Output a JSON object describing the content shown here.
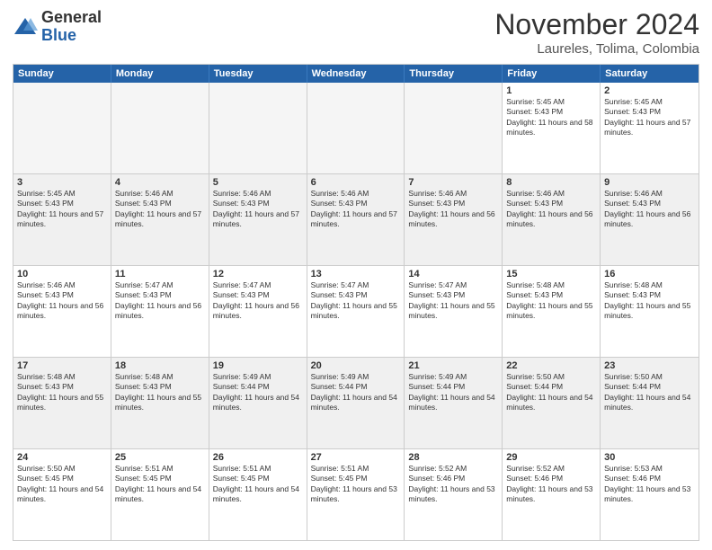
{
  "logo": {
    "general": "General",
    "blue": "Blue"
  },
  "header": {
    "month": "November 2024",
    "location": "Laureles, Tolima, Colombia"
  },
  "days_of_week": [
    "Sunday",
    "Monday",
    "Tuesday",
    "Wednesday",
    "Thursday",
    "Friday",
    "Saturday"
  ],
  "rows": [
    [
      {
        "day": "",
        "empty": true
      },
      {
        "day": "",
        "empty": true
      },
      {
        "day": "",
        "empty": true
      },
      {
        "day": "",
        "empty": true
      },
      {
        "day": "",
        "empty": true
      },
      {
        "day": "1",
        "sunrise": "Sunrise: 5:45 AM",
        "sunset": "Sunset: 5:43 PM",
        "daylight": "Daylight: 11 hours and 58 minutes."
      },
      {
        "day": "2",
        "sunrise": "Sunrise: 5:45 AM",
        "sunset": "Sunset: 5:43 PM",
        "daylight": "Daylight: 11 hours and 57 minutes."
      }
    ],
    [
      {
        "day": "3",
        "sunrise": "Sunrise: 5:45 AM",
        "sunset": "Sunset: 5:43 PM",
        "daylight": "Daylight: 11 hours and 57 minutes."
      },
      {
        "day": "4",
        "sunrise": "Sunrise: 5:46 AM",
        "sunset": "Sunset: 5:43 PM",
        "daylight": "Daylight: 11 hours and 57 minutes."
      },
      {
        "day": "5",
        "sunrise": "Sunrise: 5:46 AM",
        "sunset": "Sunset: 5:43 PM",
        "daylight": "Daylight: 11 hours and 57 minutes."
      },
      {
        "day": "6",
        "sunrise": "Sunrise: 5:46 AM",
        "sunset": "Sunset: 5:43 PM",
        "daylight": "Daylight: 11 hours and 57 minutes."
      },
      {
        "day": "7",
        "sunrise": "Sunrise: 5:46 AM",
        "sunset": "Sunset: 5:43 PM",
        "daylight": "Daylight: 11 hours and 56 minutes."
      },
      {
        "day": "8",
        "sunrise": "Sunrise: 5:46 AM",
        "sunset": "Sunset: 5:43 PM",
        "daylight": "Daylight: 11 hours and 56 minutes."
      },
      {
        "day": "9",
        "sunrise": "Sunrise: 5:46 AM",
        "sunset": "Sunset: 5:43 PM",
        "daylight": "Daylight: 11 hours and 56 minutes."
      }
    ],
    [
      {
        "day": "10",
        "sunrise": "Sunrise: 5:46 AM",
        "sunset": "Sunset: 5:43 PM",
        "daylight": "Daylight: 11 hours and 56 minutes."
      },
      {
        "day": "11",
        "sunrise": "Sunrise: 5:47 AM",
        "sunset": "Sunset: 5:43 PM",
        "daylight": "Daylight: 11 hours and 56 minutes."
      },
      {
        "day": "12",
        "sunrise": "Sunrise: 5:47 AM",
        "sunset": "Sunset: 5:43 PM",
        "daylight": "Daylight: 11 hours and 56 minutes."
      },
      {
        "day": "13",
        "sunrise": "Sunrise: 5:47 AM",
        "sunset": "Sunset: 5:43 PM",
        "daylight": "Daylight: 11 hours and 55 minutes."
      },
      {
        "day": "14",
        "sunrise": "Sunrise: 5:47 AM",
        "sunset": "Sunset: 5:43 PM",
        "daylight": "Daylight: 11 hours and 55 minutes."
      },
      {
        "day": "15",
        "sunrise": "Sunrise: 5:48 AM",
        "sunset": "Sunset: 5:43 PM",
        "daylight": "Daylight: 11 hours and 55 minutes."
      },
      {
        "day": "16",
        "sunrise": "Sunrise: 5:48 AM",
        "sunset": "Sunset: 5:43 PM",
        "daylight": "Daylight: 11 hours and 55 minutes."
      }
    ],
    [
      {
        "day": "17",
        "sunrise": "Sunrise: 5:48 AM",
        "sunset": "Sunset: 5:43 PM",
        "daylight": "Daylight: 11 hours and 55 minutes."
      },
      {
        "day": "18",
        "sunrise": "Sunrise: 5:48 AM",
        "sunset": "Sunset: 5:43 PM",
        "daylight": "Daylight: 11 hours and 55 minutes."
      },
      {
        "day": "19",
        "sunrise": "Sunrise: 5:49 AM",
        "sunset": "Sunset: 5:44 PM",
        "daylight": "Daylight: 11 hours and 54 minutes."
      },
      {
        "day": "20",
        "sunrise": "Sunrise: 5:49 AM",
        "sunset": "Sunset: 5:44 PM",
        "daylight": "Daylight: 11 hours and 54 minutes."
      },
      {
        "day": "21",
        "sunrise": "Sunrise: 5:49 AM",
        "sunset": "Sunset: 5:44 PM",
        "daylight": "Daylight: 11 hours and 54 minutes."
      },
      {
        "day": "22",
        "sunrise": "Sunrise: 5:50 AM",
        "sunset": "Sunset: 5:44 PM",
        "daylight": "Daylight: 11 hours and 54 minutes."
      },
      {
        "day": "23",
        "sunrise": "Sunrise: 5:50 AM",
        "sunset": "Sunset: 5:44 PM",
        "daylight": "Daylight: 11 hours and 54 minutes."
      }
    ],
    [
      {
        "day": "24",
        "sunrise": "Sunrise: 5:50 AM",
        "sunset": "Sunset: 5:45 PM",
        "daylight": "Daylight: 11 hours and 54 minutes."
      },
      {
        "day": "25",
        "sunrise": "Sunrise: 5:51 AM",
        "sunset": "Sunset: 5:45 PM",
        "daylight": "Daylight: 11 hours and 54 minutes."
      },
      {
        "day": "26",
        "sunrise": "Sunrise: 5:51 AM",
        "sunset": "Sunset: 5:45 PM",
        "daylight": "Daylight: 11 hours and 54 minutes."
      },
      {
        "day": "27",
        "sunrise": "Sunrise: 5:51 AM",
        "sunset": "Sunset: 5:45 PM",
        "daylight": "Daylight: 11 hours and 53 minutes."
      },
      {
        "day": "28",
        "sunrise": "Sunrise: 5:52 AM",
        "sunset": "Sunset: 5:46 PM",
        "daylight": "Daylight: 11 hours and 53 minutes."
      },
      {
        "day": "29",
        "sunrise": "Sunrise: 5:52 AM",
        "sunset": "Sunset: 5:46 PM",
        "daylight": "Daylight: 11 hours and 53 minutes."
      },
      {
        "day": "30",
        "sunrise": "Sunrise: 5:53 AM",
        "sunset": "Sunset: 5:46 PM",
        "daylight": "Daylight: 11 hours and 53 minutes."
      }
    ]
  ]
}
